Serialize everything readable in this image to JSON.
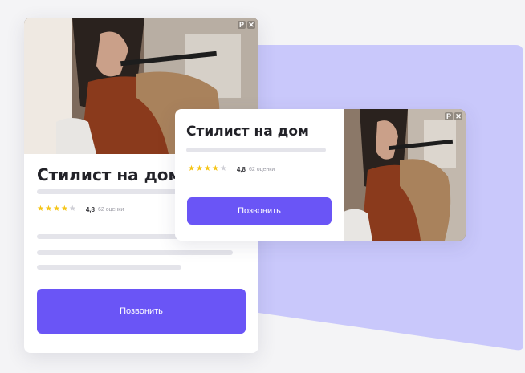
{
  "colors": {
    "background": "#f4f4f6",
    "lavender_panel": "#c9c8fb",
    "accent_button": "#6a55f6",
    "star_filled": "#f5c518",
    "star_empty": "#cfcfd6",
    "text": "#222228"
  },
  "ad_mark": {
    "badge": "P",
    "close": "✕"
  },
  "large_card": {
    "title": "Стилист на дом",
    "rating": {
      "filled_stars": 4,
      "total_stars": 5,
      "score": "4,8",
      "count": "62 оценки"
    },
    "button_label": "Позвонить",
    "image": "hairstylist-photo"
  },
  "small_card": {
    "title": "Стилист на дом",
    "rating": {
      "filled_stars": 4,
      "total_stars": 5,
      "score": "4,8",
      "count": "62 оценки"
    },
    "button_label": "Позвонить",
    "image": "hairstylist-photo"
  }
}
